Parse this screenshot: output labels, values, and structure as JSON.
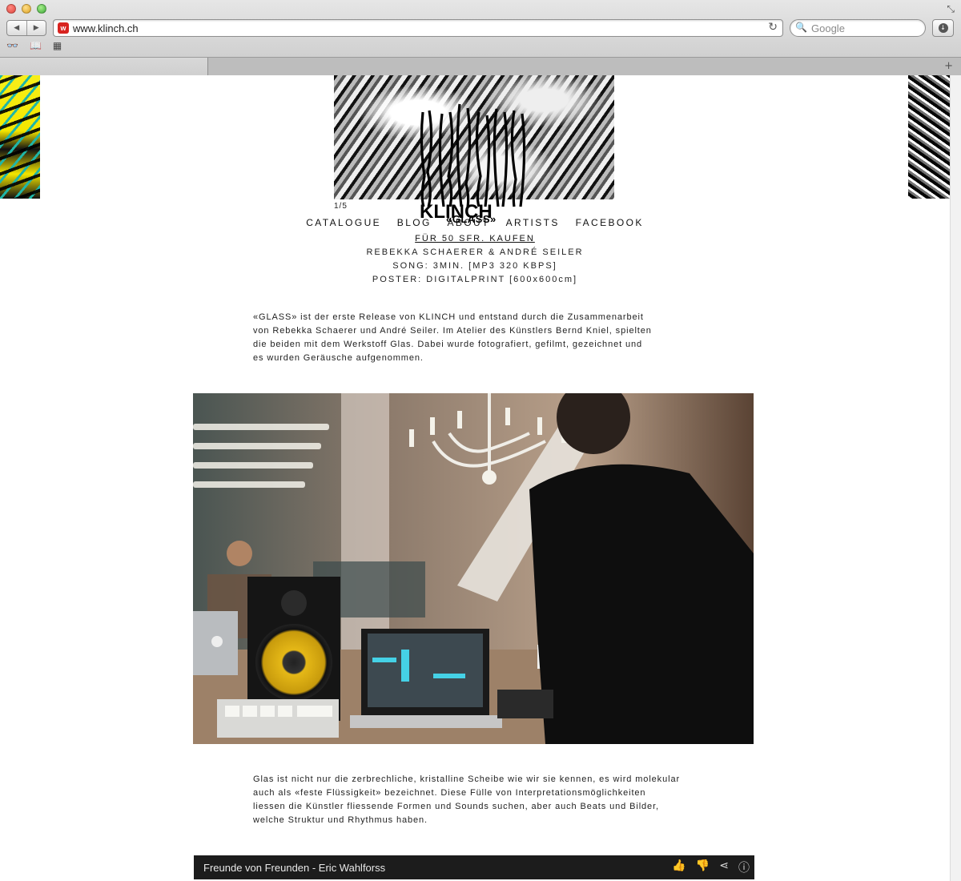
{
  "browser": {
    "url": "www.klinch.ch",
    "search_placeholder": "Google",
    "back_glyph": "◀",
    "forward_glyph": "▶",
    "reload_glyph": "↻",
    "search_glyph": "🔍",
    "download_glyph": "↓",
    "reader_glyph": "👓",
    "bookmarks_glyph": "📖",
    "topsites_glyph": "▦",
    "newtab_glyph": "+",
    "resize_glyph": "⤡",
    "favicon_letter": "w"
  },
  "site": {
    "slide_counter": "1/5",
    "logo_text": "KLINCH",
    "release_title": "«GLASS»",
    "menu": [
      "CATALOGUE",
      "BLOG",
      "ABOUT",
      "ARTISTS",
      "FACEBOOK"
    ],
    "buy_link": "FÜR 50 SFR. KAUFEN",
    "credits": "REBEKKA SCHAERER & ANDRÉ SEILER",
    "song": "SONG: 3MIN. [MP3 320 KBPS]",
    "poster": "POSTER: DIGITALPRINT [600x600cm]"
  },
  "paragraphs": {
    "intro": [
      "«GLASS» ist der erste Release von KLINCH und entstand durch die Zusammenarbeit",
      "von Rebekka Schaerer und André Seiler. Im Atelier des Künstlers Bernd Kniel, spielten",
      "die beiden mit dem Werkstoff Glas. Dabei wurde fotografiert, gefilmt, gezeichnet und",
      "es wurden Geräusche aufgenommen."
    ],
    "second": [
      "Glas ist nicht nur die zerbrechliche, kristalline Scheibe wie wir sie kennen, es wird molekular",
      "auch als «feste Flüssigkeit» bezeichnet. Diese Fülle von Interpretationsmöglichkeiten",
      "liessen die Künstler fliessende Formen und Sounds suchen, aber auch Beats und Bilder,",
      "welche Struktur und Rhythmus haben."
    ]
  },
  "player": {
    "title": "Freunde von Freunden - Eric Wahlforss",
    "icons": [
      "like-icon",
      "dislike-icon",
      "share-icon",
      "info-icon"
    ],
    "like_glyph": "👍",
    "dislike_glyph": "👎",
    "share_glyph": "⋖",
    "info_glyph": "ⓘ"
  },
  "colors": {
    "background": "#ffffff",
    "text": "#222222",
    "player_bar": "#1c1c1c",
    "art_yellow": "#f4e600",
    "art_teal": "#1fb6a8"
  }
}
